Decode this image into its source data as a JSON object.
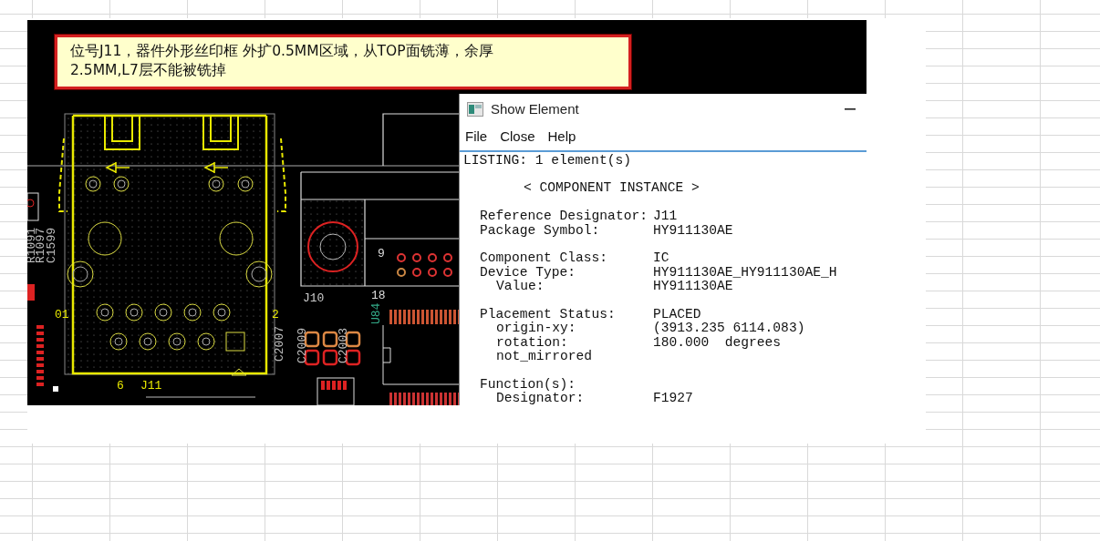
{
  "annotation": {
    "lines": [
      "位号J11，器件外形丝印框 外扩0.5MM区域，从TOP面铣薄，余厚",
      "2.5MM,L7层不能被铣掉"
    ]
  },
  "pcb_labels": [
    {
      "text": "J11",
      "kind": "horizontal"
    },
    {
      "text": "J10",
      "kind": "horizontal"
    },
    {
      "text": "18",
      "kind": "horizontal"
    },
    {
      "text": "9",
      "kind": "horizontal"
    },
    {
      "text": "6",
      "kind": "horizontal"
    },
    {
      "text": "01",
      "kind": "horizontal"
    },
    {
      "text": "2",
      "kind": "horizontal"
    },
    {
      "text": "R1091",
      "kind": "vertical"
    },
    {
      "text": "R1097",
      "kind": "vertical"
    },
    {
      "text": "C1599",
      "kind": "vertical"
    },
    {
      "text": "C2007",
      "kind": "vertical"
    },
    {
      "text": "C2009",
      "kind": "vertical"
    },
    {
      "text": "C2003",
      "kind": "vertical"
    },
    {
      "text": "U84",
      "kind": "vertical"
    }
  ],
  "element_window": {
    "title": "Show Element",
    "menu": [
      "File",
      "Close",
      "Help"
    ],
    "listing_header": "LISTING: 1 element(s)",
    "section_title": "< COMPONENT INSTANCE >",
    "groups": [
      {
        "fields": [
          {
            "kind": "main",
            "label": "Reference Designator:",
            "value": "J11"
          },
          {
            "kind": "main",
            "label": "Package Symbol:",
            "value": "HY911130AE"
          }
        ]
      },
      {
        "fields": [
          {
            "kind": "main",
            "label": "Component Class:",
            "value": "IC"
          },
          {
            "kind": "main",
            "label": "Device Type:",
            "value": "HY911130AE_HY911130AE_H"
          },
          {
            "kind": "sub",
            "label": "Value:",
            "value": "HY911130AE"
          }
        ]
      },
      {
        "fields": [
          {
            "kind": "main",
            "label": "Placement Status:",
            "value": "PLACED"
          },
          {
            "kind": "sub",
            "label": "origin-xy:",
            "value": "(3913.235 6114.083)"
          },
          {
            "kind": "sub",
            "label": "rotation:",
            "value": "180.000  degrees"
          },
          {
            "kind": "sub",
            "label": "not_mirrored"
          }
        ]
      },
      {
        "fields": [
          {
            "kind": "main",
            "label": "Function(s):"
          },
          {
            "kind": "sub",
            "label": "Designator:",
            "value": "F1927"
          }
        ]
      }
    ]
  }
}
